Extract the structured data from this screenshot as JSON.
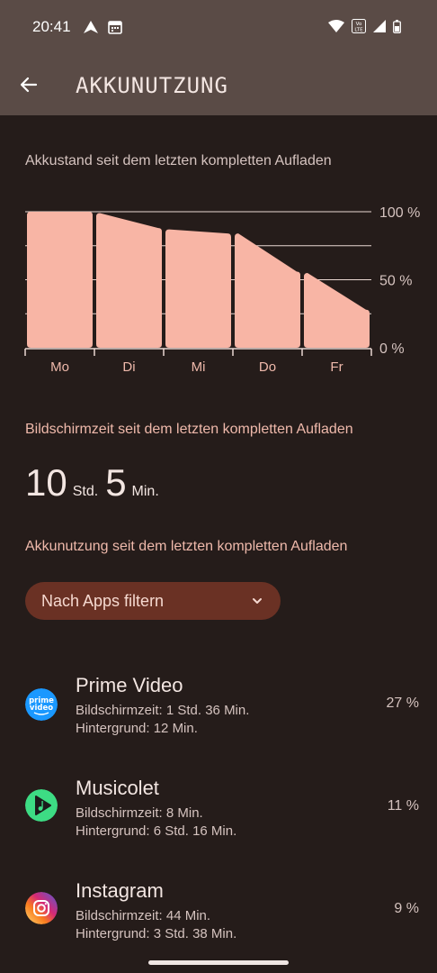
{
  "statusbar": {
    "time": "20:41"
  },
  "appbar": {
    "title": "AKKUNUTZUNG"
  },
  "battery_section": {
    "heading": "Akkustand seit dem letzten kompletten Aufladen"
  },
  "chart_data": {
    "type": "area",
    "categories": [
      "Mo",
      "Di",
      "Mi",
      "Do",
      "Fr"
    ],
    "y_tick_labels": [
      "100 %",
      "50 %",
      "0 %"
    ],
    "ylim": [
      0,
      100
    ],
    "series": [
      {
        "values": [
          [
            100,
            100
          ],
          [
            99,
            88
          ],
          [
            87,
            84
          ],
          [
            84,
            56
          ],
          [
            55,
            28
          ]
        ]
      }
    ],
    "grid": true,
    "color": "#f8b5a5"
  },
  "screentime": {
    "heading": "Bildschirmzeit seit dem letzten kompletten Aufladen",
    "hours": "10",
    "hours_unit": "Std.",
    "minutes": "5",
    "minutes_unit": "Min."
  },
  "usage": {
    "heading": "Akkunutzung seit dem letzten kompletten Aufladen",
    "filter_label": "Nach Apps filtern"
  },
  "apps": [
    {
      "name": "Prime Video",
      "screen": "Bildschirmzeit: 1 Std. 36 Min.",
      "background": "Hintergrund: 12 Min.",
      "percent": "27 %",
      "icon": "prime-video-icon"
    },
    {
      "name": "Musicolet",
      "screen": "Bildschirmzeit: 8 Min.",
      "background": "Hintergrund: 6 Std. 16 Min.",
      "percent": "11 %",
      "icon": "musicolet-icon"
    },
    {
      "name": "Instagram",
      "screen": "Bildschirmzeit: 44 Min.",
      "background": "Hintergrund: 3 Std. 38 Min.",
      "percent": "9 %",
      "icon": "instagram-icon"
    }
  ]
}
